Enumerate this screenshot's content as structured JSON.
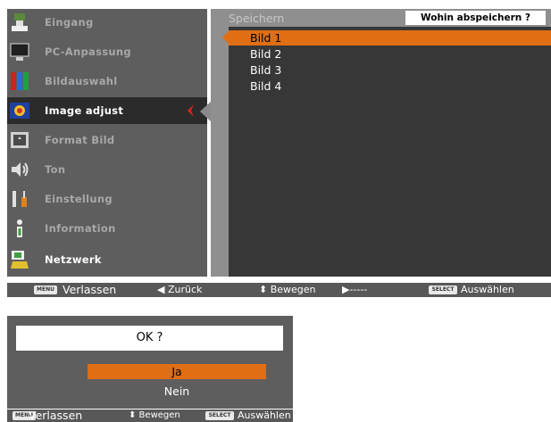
{
  "sidebar": {
    "items": [
      {
        "label": "Eingang",
        "icon": "input-monitor-icon"
      },
      {
        "label": "PC-Anpassung",
        "icon": "pc-adjust-icon"
      },
      {
        "label": "Bildauswahl",
        "icon": "image-select-icon"
      },
      {
        "label": "Image adjust",
        "icon": "image-adjust-icon"
      },
      {
        "label": "Format Bild",
        "icon": "screen-format-icon"
      },
      {
        "label": "Ton",
        "icon": "speaker-icon"
      },
      {
        "label": "Einstellung",
        "icon": "setting-tools-icon"
      },
      {
        "label": "Information",
        "icon": "information-icon"
      },
      {
        "label": "Netzwerk",
        "icon": "network-icon"
      }
    ],
    "active_index": 3
  },
  "content": {
    "title": "Speichern",
    "hint": "Wohin abspeichern ?",
    "options": [
      "Bild 1",
      "Bild 2",
      "Bild 3",
      "Bild 4"
    ],
    "selected_option": "Bild 1"
  },
  "status_bar": {
    "menu_key": "MENU",
    "exit": "Verlassen",
    "back": "◀ Zurück",
    "move": "⬍ Bewegen",
    "next": "▶-----",
    "select_key": "SELECT",
    "select": "Auswählen"
  },
  "confirm_dialog": {
    "question": "OK ?",
    "yes": "Ja",
    "no": "Nein",
    "status": {
      "menu_key": "MENU",
      "exit": "Verlassen",
      "move": "⬍ Bewegen",
      "select_key": "SELECT",
      "select": "Auswählen"
    }
  },
  "colors": {
    "highlight": "#e06e14",
    "panel": "#5e5e5e",
    "content_bg": "#373737"
  }
}
